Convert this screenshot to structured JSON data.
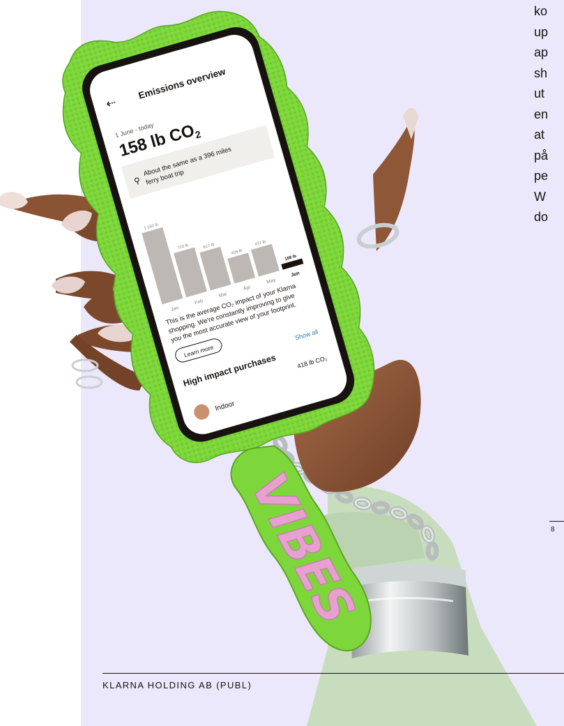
{
  "side_text": {
    "lines": [
      "ko",
      "up",
      "ap",
      "sh",
      "ut",
      "en",
      "at",
      "på",
      "pe",
      "W",
      "do"
    ]
  },
  "page_number": "8",
  "footer": {
    "company": "KLARNA HOLDING AB (PUBL)"
  },
  "phone_screen": {
    "back_icon": "back-arrow-icon",
    "title": "Emissions overview",
    "date_range": "1 June - today",
    "total_value": "158 lb CO",
    "total_subscript": "2",
    "comparison_icon": "ferry-icon",
    "comparison_line1": "About the same as a 396 miles",
    "comparison_line2": "ferry boat trip",
    "description_line1": "This is the average CO₂ impact of your Klarna",
    "description_line2": "shopping. We're constantly improving to give",
    "description_line3": "you the most accurate view of your footprint.",
    "learn_more_label": "Learn more",
    "show_all_label": "Show all",
    "high_impact_heading": "High impact purchases",
    "purchase_name": "Indoor",
    "purchase_value": "418 lb CO₂",
    "colors": {
      "bar": "#bdb8b4",
      "bar_current": "#17120f",
      "case_green": "#7dd63a",
      "card_bg": "#f1efec"
    }
  },
  "keychain_text": "VIBES",
  "chart_data": {
    "type": "bar",
    "categories": [
      "Jan",
      "Feb",
      "Mar",
      "Apr",
      "May",
      "Jun"
    ],
    "values": [
      1160,
      720,
      617,
      405,
      437,
      158
    ],
    "value_labels": [
      "1 160 lb",
      "720 lb",
      "617 lb",
      "405 lb",
      "437 lb",
      "158 lb"
    ],
    "highlight_index": 5,
    "title": "",
    "xlabel": "",
    "ylabel": ""
  }
}
